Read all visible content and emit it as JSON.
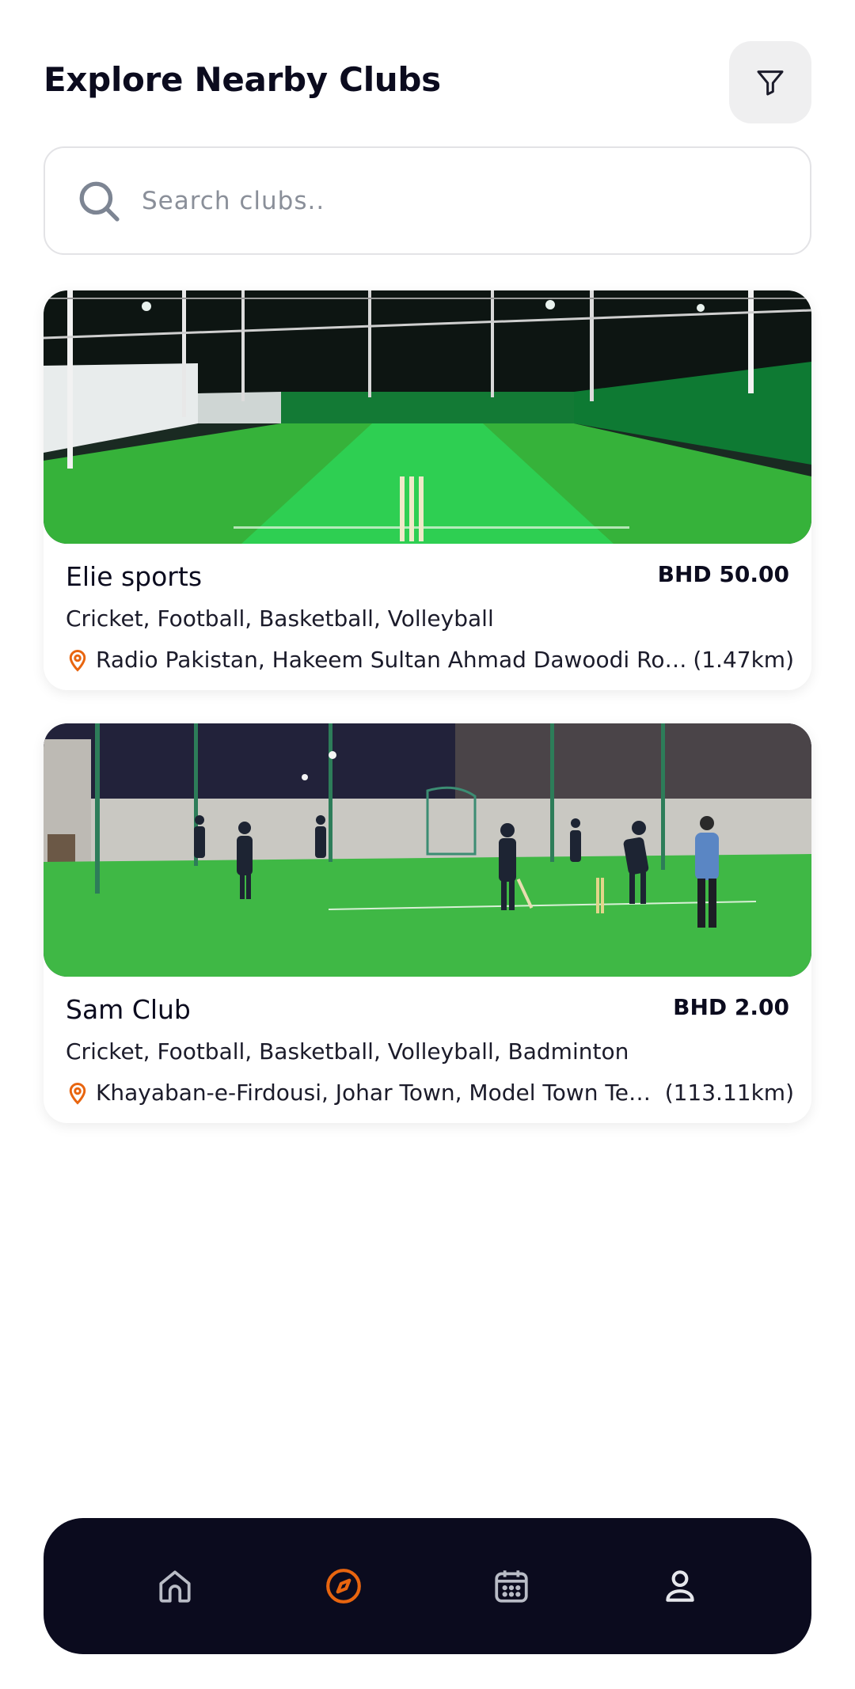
{
  "header": {
    "title": "Explore Nearby Clubs"
  },
  "search": {
    "placeholder": "Search clubs.."
  },
  "clubs": [
    {
      "name": "Elie sports",
      "price": "BHD 50.00",
      "sports": "Cricket, Football, Basketball, Volleyball",
      "location": "Radio Pakistan, Hakeem Sultan Ahmad Dawoodi Road...",
      "distance": "(1.47km)"
    },
    {
      "name": "Sam Club",
      "price": "BHD 2.00",
      "sports": "Cricket, Football, Basketball, Volleyball, Badminton",
      "location": "Khayaban-e-Firdousi, Johar Town, Model Town Tehs...",
      "distance": "(113.11km)"
    }
  ],
  "nav": {
    "items": [
      {
        "icon": "home-icon",
        "active": false
      },
      {
        "icon": "compass-icon",
        "active": true
      },
      {
        "icon": "calendar-icon",
        "active": false
      },
      {
        "icon": "profile-icon",
        "active": false
      }
    ]
  },
  "colors": {
    "accent": "#e8650f",
    "nav_bg": "#0b0b1e",
    "nav_icon": "#b9bcc6",
    "text": "#0b0b1e"
  }
}
